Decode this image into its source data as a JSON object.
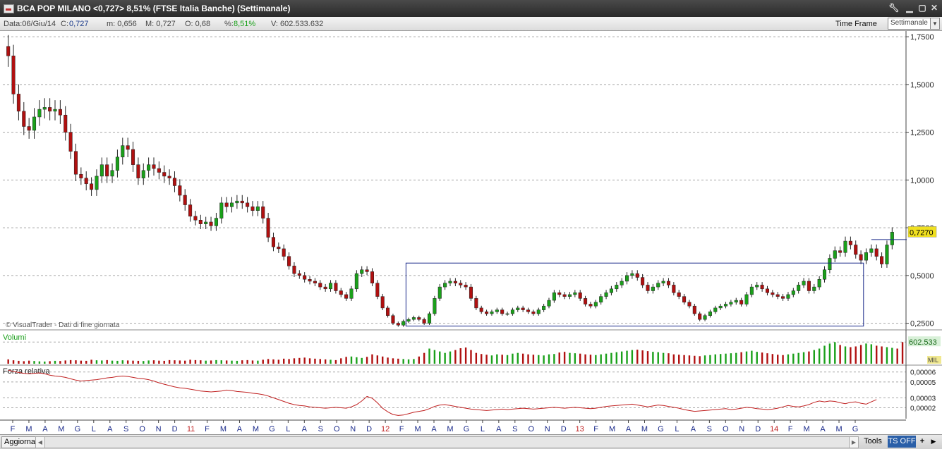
{
  "window": {
    "title": "BCA POP MILANO <0,727> 8,51%  (FTSE Italia Banche)  (Settimanale)",
    "icons": [
      "wrench-icon",
      "minimize-icon",
      "maximize-icon",
      "close-icon"
    ]
  },
  "info": {
    "data": "Data:06/Giu/14",
    "c_label": "C:",
    "c_value": "0,727",
    "m": "m: 0,656",
    "M": "M: 0,727",
    "o": "O: 0,68",
    "pct_label": "%:",
    "pct_value": "8,51%",
    "v": "V: 602.533.632",
    "time_frame_label": "Time Frame",
    "time_frame_value": "Settimanale"
  },
  "bottom": {
    "refresh_label": "Aggiorna",
    "tools_label": "Tools",
    "ts_label": "TS OFF",
    "plus_label": "+"
  },
  "colors": {
    "up": "#1aa01a",
    "down": "#b01010",
    "rs_line": "#c02020",
    "box": "#1a2a8a",
    "price_tag": "#f0e020",
    "grid": "#a8a8a8"
  },
  "chart_data": [
    {
      "type": "candlestick",
      "panel": "price",
      "watermark": "© VisualTrader - Dati di fine giornata",
      "y_ticks": [
        "1,7500",
        "1,5000",
        "1,2500",
        "1,0000",
        "0,7500",
        "0,5000",
        "0,2500"
      ],
      "y_tick_values": [
        1.75,
        1.5,
        1.25,
        1.0,
        0.75,
        0.5,
        0.25
      ],
      "ylim": [
        0.23,
        1.78
      ],
      "last_price_label": "0,7270",
      "last_price": 0.727,
      "x_labels": [
        "F",
        "M",
        "A",
        "M",
        "G",
        "L",
        "A",
        "S",
        "O",
        "N",
        "D",
        "11",
        "F",
        "M",
        "A",
        "M",
        "G",
        "L",
        "A",
        "S",
        "O",
        "N",
        "D",
        "12",
        "F",
        "M",
        "A",
        "M",
        "G",
        "L",
        "A",
        "S",
        "O",
        "N",
        "D",
        "13",
        "F",
        "M",
        "A",
        "M",
        "G",
        "L",
        "A",
        "S",
        "O",
        "N",
        "D",
        "14",
        "F",
        "M",
        "A",
        "M",
        "G"
      ],
      "closes": [
        1.65,
        1.45,
        1.36,
        1.28,
        1.26,
        1.33,
        1.37,
        1.38,
        1.36,
        1.37,
        1.34,
        1.25,
        1.15,
        1.03,
        1.01,
        0.98,
        0.95,
        1.02,
        1.08,
        1.02,
        1.05,
        1.12,
        1.18,
        1.16,
        1.08,
        1.01,
        1.05,
        1.08,
        1.06,
        1.04,
        1.02,
        1.01,
        0.97,
        0.92,
        0.87,
        0.81,
        0.79,
        0.77,
        0.78,
        0.76,
        0.8,
        0.88,
        0.86,
        0.88,
        0.89,
        0.88,
        0.86,
        0.84,
        0.86,
        0.8,
        0.7,
        0.65,
        0.64,
        0.6,
        0.55,
        0.51,
        0.5,
        0.48,
        0.47,
        0.46,
        0.44,
        0.43,
        0.46,
        0.42,
        0.4,
        0.38,
        0.43,
        0.51,
        0.53,
        0.52,
        0.46,
        0.39,
        0.33,
        0.29,
        0.25,
        0.24,
        0.26,
        0.27,
        0.28,
        0.27,
        0.25,
        0.3,
        0.38,
        0.44,
        0.46,
        0.47,
        0.46,
        0.45,
        0.44,
        0.38,
        0.33,
        0.31,
        0.3,
        0.31,
        0.32,
        0.3,
        0.3,
        0.32,
        0.33,
        0.32,
        0.31,
        0.3,
        0.32,
        0.34,
        0.37,
        0.41,
        0.4,
        0.39,
        0.4,
        0.41,
        0.38,
        0.35,
        0.34,
        0.36,
        0.39,
        0.41,
        0.43,
        0.45,
        0.47,
        0.5,
        0.51,
        0.49,
        0.45,
        0.42,
        0.44,
        0.46,
        0.47,
        0.45,
        0.41,
        0.39,
        0.36,
        0.34,
        0.3,
        0.27,
        0.29,
        0.31,
        0.33,
        0.34,
        0.35,
        0.36,
        0.37,
        0.35,
        0.4,
        0.44,
        0.45,
        0.43,
        0.41,
        0.4,
        0.39,
        0.38,
        0.4,
        0.42,
        0.45,
        0.47,
        0.42,
        0.44,
        0.48,
        0.53,
        0.59,
        0.63,
        0.62,
        0.68,
        0.66,
        0.61,
        0.58,
        0.62,
        0.64,
        0.6,
        0.56,
        0.66,
        0.727
      ],
      "range_box": {
        "x_start_index": 77,
        "x_end_index": 164,
        "low": 0.235,
        "high": 0.565
      },
      "resistance_line": {
        "x_start_index": 166,
        "x_end_index": 172,
        "value": 0.688
      }
    },
    {
      "type": "bar",
      "panel": "volume",
      "title": "Volumi",
      "y_tick_label": "602.533",
      "unit_label": "MIL",
      "ylim": [
        0,
        900
      ],
      "values": [
        120,
        95,
        80,
        70,
        85,
        75,
        65,
        60,
        70,
        80,
        75,
        90,
        100,
        95,
        85,
        80,
        110,
        95,
        90,
        100,
        85,
        80,
        95,
        90,
        85,
        80,
        75,
        90,
        95,
        85,
        80,
        100,
        95,
        90,
        85,
        110,
        100,
        95,
        85,
        90,
        100,
        95,
        90,
        85,
        80,
        95,
        100,
        90,
        85,
        110,
        130,
        120,
        110,
        140,
        130,
        150,
        160,
        170,
        150,
        140,
        130,
        120,
        110,
        100,
        150,
        190,
        200,
        180,
        160,
        190,
        260,
        230,
        200,
        170,
        150,
        140,
        130,
        120,
        130,
        200,
        300,
        420,
        380,
        340,
        300,
        340,
        380,
        430,
        450,
        380,
        300,
        270,
        250,
        230,
        260,
        250,
        240,
        280,
        300,
        280,
        260,
        250,
        240,
        230,
        260,
        270,
        310,
        330,
        300,
        290,
        280,
        260,
        250,
        240,
        260,
        280,
        300,
        320,
        340,
        360,
        380,
        390,
        370,
        350,
        330,
        320,
        300,
        290,
        260,
        250,
        240,
        230,
        220,
        210,
        230,
        240,
        260,
        270,
        280,
        290,
        300,
        320,
        340,
        360,
        330,
        310,
        290,
        270,
        250,
        240,
        260,
        280,
        300,
        320,
        340,
        380,
        420,
        500,
        560,
        600,
        520,
        480,
        460,
        480,
        520,
        560,
        540,
        500,
        480,
        460,
        440,
        420,
        600
      ]
    },
    {
      "type": "line",
      "panel": "relative_strength",
      "title": "Forza relativa",
      "y_ticks": [
        "0,00006",
        "0,00005",
        "0,00003",
        "0,00002"
      ],
      "y_tick_values": [
        6.2e-05,
        5.1e-05,
        3.35e-05,
        2.25e-05
      ],
      "ylim": [
        1.2e-05,
        6.8e-05
      ],
      "values": [
        6.4e-05,
        6.25e-05,
        6.15e-05,
        6.05e-05,
        6e-05,
        6.05e-05,
        6.1e-05,
        6e-05,
        5.85e-05,
        5.75e-05,
        5.7e-05,
        5.6e-05,
        5.45e-05,
        5.3e-05,
        5.2e-05,
        5.25e-05,
        5.3e-05,
        5.35e-05,
        5.45e-05,
        5.55e-05,
        5.6e-05,
        5.7e-05,
        5.75e-05,
        5.7e-05,
        5.6e-05,
        5.5e-05,
        5.45e-05,
        5.35e-05,
        5.2e-05,
        5e-05,
        4.85e-05,
        4.7e-05,
        4.55e-05,
        4.45e-05,
        4.4e-05,
        4.3e-05,
        4.2e-05,
        4.1e-05,
        4.05e-05,
        4e-05,
        4.05e-05,
        4.1e-05,
        4.2e-05,
        4.15e-05,
        4.05e-05,
        4e-05,
        3.95e-05,
        3.85e-05,
        3.8e-05,
        3.7e-05,
        3.55e-05,
        3.35e-05,
        3.15e-05,
        2.95e-05,
        2.75e-05,
        2.6e-05,
        2.5e-05,
        2.45e-05,
        2.35e-05,
        2.3e-05,
        2.25e-05,
        2.2e-05,
        2.25e-05,
        2.3e-05,
        2.25e-05,
        2.2e-05,
        2.35e-05,
        2.6e-05,
        3e-05,
        3.5e-05,
        3.3e-05,
        2.8e-05,
        2.2e-05,
        1.8e-05,
        1.5e-05,
        1.4e-05,
        1.45e-05,
        1.6e-05,
        1.75e-05,
        1.85e-05,
        1.95e-05,
        2.15e-05,
        2.4e-05,
        2.55e-05,
        2.6e-05,
        2.5e-05,
        2.4e-05,
        2.3e-05,
        2.2e-05,
        2.1e-05,
        2.05e-05,
        2e-05,
        1.95e-05,
        2e-05,
        2.05e-05,
        2.1e-05,
        2.05e-05,
        2.1e-05,
        2.15e-05,
        2.2e-05,
        2.15e-05,
        2.1e-05,
        2.15e-05,
        2.2e-05,
        2.25e-05,
        2.3e-05,
        2.25e-05,
        2.2e-05,
        2.25e-05,
        2.3e-05,
        2.25e-05,
        2.2e-05,
        2.15e-05,
        2.2e-05,
        2.3e-05,
        2.4e-05,
        2.45e-05,
        2.5e-05,
        2.55e-05,
        2.6e-05,
        2.65e-05,
        2.55e-05,
        2.45e-05,
        2.35e-05,
        2.45e-05,
        2.55e-05,
        2.5e-05,
        2.4e-05,
        2.3e-05,
        2.2e-05,
        2.05e-05,
        1.95e-05,
        1.85e-05,
        1.9e-05,
        1.95e-05,
        2e-05,
        2.05e-05,
        2.1e-05,
        2.15e-05,
        2.05e-05,
        2.1e-05,
        2.2e-05,
        2.3e-05,
        2.25e-05,
        2.15e-05,
        2.1e-05,
        2.05e-05,
        2.1e-05,
        2.2e-05,
        2.35e-05,
        2.5e-05,
        2.4e-05,
        2.35e-05,
        2.45e-05,
        2.6e-05,
        2.85e-05,
        3e-05,
        2.9e-05,
        3e-05,
        2.95e-05,
        2.8e-05,
        2.7e-05,
        2.85e-05,
        2.9e-05,
        2.75e-05,
        2.65e-05,
        2.9e-05,
        3.15e-05
      ]
    }
  ]
}
